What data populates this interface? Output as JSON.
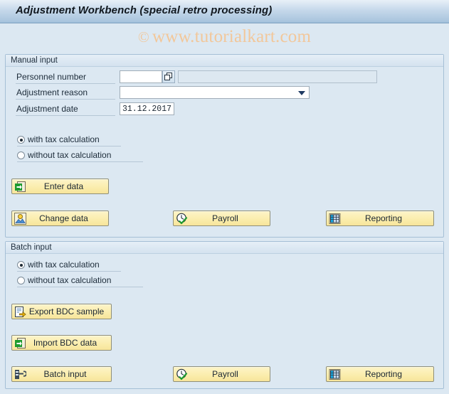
{
  "window": {
    "title": "Adjustment Workbench (special retro processing)"
  },
  "watermark": {
    "copyright": "©",
    "text": "www.tutorialkart.com"
  },
  "manual_input": {
    "legend": "Manual input",
    "fields": [
      {
        "label": "Personnel number",
        "value": "",
        "f4_icon": "search-help-icon",
        "description_value": ""
      },
      {
        "label": "Adjustment reason",
        "value": "",
        "dropdown_icon": "chevron-down-icon"
      },
      {
        "label": "Adjustment date",
        "value": "31.12.2017"
      }
    ],
    "radios": [
      {
        "label": "with tax calculation",
        "selected": true
      },
      {
        "label": "without tax calculation",
        "selected": false
      }
    ],
    "buttons": [
      {
        "label": "Enter data",
        "icon": "enter-data-icon"
      },
      {
        "label": "Change data",
        "icon": "person-icon"
      },
      {
        "label": "Payroll",
        "icon": "clock-check-icon"
      },
      {
        "label": "Reporting",
        "icon": "table-grid-icon"
      }
    ]
  },
  "batch_input": {
    "legend": "Batch input",
    "radios": [
      {
        "label": "with tax calculation",
        "selected": true
      },
      {
        "label": "without tax calculation",
        "selected": false
      }
    ],
    "buttons": [
      {
        "label": "Export BDC sample",
        "icon": "export-document-icon"
      },
      {
        "label": "Import BDC data",
        "icon": "import-document-icon"
      },
      {
        "label": "Batch input",
        "icon": "batch-tool-icon"
      },
      {
        "label": "Payroll",
        "icon": "clock-check-icon"
      },
      {
        "label": "Reporting",
        "icon": "table-grid-icon"
      }
    ]
  },
  "colors": {
    "background": "#dce8f2",
    "titlebar_top": "#e8f0f8",
    "titlebar_bottom": "#8fb2d2",
    "button_face": "#fbeeb0",
    "watermark": "#f2c79a",
    "frame_border": "#a5bfd6"
  }
}
